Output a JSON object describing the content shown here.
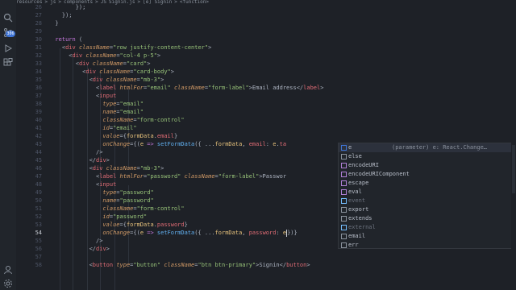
{
  "breadcrumb": [
    "resources",
    ">",
    "js",
    ">",
    "components",
    ">",
    "JS",
    "Signin.js",
    ">",
    "[e] Signin",
    ">",
    "<function>"
  ],
  "activity": {
    "badge": "306"
  },
  "line_numbers": [
    "26",
    "27",
    "28",
    "29",
    "30",
    "31",
    "32",
    "33",
    "34",
    "35",
    "36",
    "37",
    "38",
    "39",
    "40",
    "41",
    "42",
    "43",
    "44",
    "45",
    "46",
    "47",
    "48",
    "49",
    "50",
    "51",
    "52",
    "53",
    "54",
    "55",
    "56",
    "57",
    "58"
  ],
  "active_line": "54",
  "code": [
    [
      [
        "t-punc",
        "        });"
      ]
    ],
    [
      [
        "t-punc",
        "    });"
      ]
    ],
    [
      [
        "t-punc",
        "  }"
      ]
    ],
    [
      [
        "t-punc",
        ""
      ]
    ],
    [
      [
        "t-kw",
        "  return"
      ],
      [
        "t-punc",
        " ("
      ]
    ],
    [
      [
        "t-punc",
        "    <"
      ],
      [
        "t-tag",
        "div"
      ],
      [
        "t-attr",
        " className"
      ],
      [
        "t-punc",
        "="
      ],
      [
        "t-str",
        "\"row justify-content-center\""
      ],
      [
        "t-punc",
        ">"
      ]
    ],
    [
      [
        "t-punc",
        "      <"
      ],
      [
        "t-tag",
        "div"
      ],
      [
        "t-attr",
        " className"
      ],
      [
        "t-punc",
        "="
      ],
      [
        "t-str",
        "\"col-4 p-5\""
      ],
      [
        "t-punc",
        ">"
      ]
    ],
    [
      [
        "t-punc",
        "        <"
      ],
      [
        "t-tag",
        "div"
      ],
      [
        "t-attr",
        " className"
      ],
      [
        "t-punc",
        "="
      ],
      [
        "t-str",
        "\"card\""
      ],
      [
        "t-punc",
        ">"
      ]
    ],
    [
      [
        "t-punc",
        "          <"
      ],
      [
        "t-tag",
        "div"
      ],
      [
        "t-attr",
        " className"
      ],
      [
        "t-punc",
        "="
      ],
      [
        "t-str",
        "\"card-body\""
      ],
      [
        "t-punc",
        ">"
      ]
    ],
    [
      [
        "t-punc",
        "            <"
      ],
      [
        "t-tag",
        "div"
      ],
      [
        "t-attr",
        " className"
      ],
      [
        "t-punc",
        "="
      ],
      [
        "t-str",
        "\"mb-3\""
      ],
      [
        "t-punc",
        ">"
      ]
    ],
    [
      [
        "t-punc",
        "              <"
      ],
      [
        "t-tag",
        "label"
      ],
      [
        "t-attr",
        " htmlFor"
      ],
      [
        "t-punc",
        "="
      ],
      [
        "t-str",
        "\"email\""
      ],
      [
        "t-attr",
        " className"
      ],
      [
        "t-punc",
        "="
      ],
      [
        "t-str",
        "\"form-label\""
      ],
      [
        "t-punc",
        ">Email address</"
      ],
      [
        "t-tag",
        "label"
      ],
      [
        "t-punc",
        ">"
      ]
    ],
    [
      [
        "t-punc",
        "              <"
      ],
      [
        "t-tag",
        "input"
      ]
    ],
    [
      [
        "t-attr",
        "                type"
      ],
      [
        "t-punc",
        "="
      ],
      [
        "t-str",
        "\"email\""
      ]
    ],
    [
      [
        "t-attr",
        "                name"
      ],
      [
        "t-punc",
        "="
      ],
      [
        "t-str",
        "\"email\""
      ]
    ],
    [
      [
        "t-attr",
        "                className"
      ],
      [
        "t-punc",
        "="
      ],
      [
        "t-str",
        "\"form-control\""
      ]
    ],
    [
      [
        "t-attr",
        "                id"
      ],
      [
        "t-punc",
        "="
      ],
      [
        "t-str",
        "\"email\""
      ]
    ],
    [
      [
        "t-attr",
        "                value"
      ],
      [
        "t-punc",
        "={"
      ],
      [
        "t-var",
        "formData"
      ],
      [
        "t-punc",
        "."
      ],
      [
        "t-prop",
        "email"
      ],
      [
        "t-punc",
        "}"
      ]
    ],
    [
      [
        "t-attr",
        "                onChange"
      ],
      [
        "t-punc",
        "={("
      ],
      [
        "t-var",
        "e"
      ],
      [
        "t-kw",
        " =>"
      ],
      [
        "t-fn",
        " setFormData"
      ],
      [
        "t-punc",
        "({ ..."
      ],
      [
        "t-var",
        "formData"
      ],
      [
        "t-punc",
        ", "
      ],
      [
        "t-prop",
        "email"
      ],
      [
        "t-punc",
        ": "
      ],
      [
        "t-var",
        "e"
      ],
      [
        "t-punc",
        "."
      ],
      [
        "t-prop",
        "ta"
      ]
    ],
    [
      [
        "t-punc",
        "              />"
      ]
    ],
    [
      [
        "t-punc",
        "            </"
      ],
      [
        "t-tag",
        "div"
      ],
      [
        "t-punc",
        ">"
      ]
    ],
    [
      [
        "t-punc",
        "            <"
      ],
      [
        "t-tag",
        "div"
      ],
      [
        "t-attr",
        " className"
      ],
      [
        "t-punc",
        "="
      ],
      [
        "t-str",
        "\"mb-3\""
      ],
      [
        "t-punc",
        ">"
      ]
    ],
    [
      [
        "t-punc",
        "              <"
      ],
      [
        "t-tag",
        "label"
      ],
      [
        "t-attr",
        " htmlFor"
      ],
      [
        "t-punc",
        "="
      ],
      [
        "t-str",
        "\"password\""
      ],
      [
        "t-attr",
        " className"
      ],
      [
        "t-punc",
        "="
      ],
      [
        "t-str",
        "\"form-label\""
      ],
      [
        "t-punc",
        ">Passwor"
      ]
    ],
    [
      [
        "t-punc",
        "              <"
      ],
      [
        "t-tag",
        "input"
      ]
    ],
    [
      [
        "t-attr",
        "                type"
      ],
      [
        "t-punc",
        "="
      ],
      [
        "t-str",
        "\"password\""
      ]
    ],
    [
      [
        "t-attr",
        "                name"
      ],
      [
        "t-punc",
        "="
      ],
      [
        "t-str",
        "\"password\""
      ]
    ],
    [
      [
        "t-attr",
        "                className"
      ],
      [
        "t-punc",
        "="
      ],
      [
        "t-str",
        "\"form-control\""
      ]
    ],
    [
      [
        "t-attr",
        "                id"
      ],
      [
        "t-punc",
        "="
      ],
      [
        "t-str",
        "\"password\""
      ]
    ],
    [
      [
        "t-attr",
        "                value"
      ],
      [
        "t-punc",
        "={"
      ],
      [
        "t-var",
        "formData"
      ],
      [
        "t-punc",
        "."
      ],
      [
        "t-prop",
        "password"
      ],
      [
        "t-punc",
        "}"
      ]
    ],
    [
      [
        "t-attr",
        "                onChange"
      ],
      [
        "t-punc",
        "={("
      ],
      [
        "t-var",
        "e"
      ],
      [
        "t-kw",
        " =>"
      ],
      [
        "t-fn",
        " setFormData"
      ],
      [
        "t-punc",
        "({ ..."
      ],
      [
        "t-var",
        "formData"
      ],
      [
        "t-punc",
        ", "
      ],
      [
        "t-prop",
        "password"
      ],
      [
        "t-punc",
        ": "
      ],
      [
        "t-var",
        "e"
      ],
      [
        "CURSOR",
        ""
      ],
      [
        "t-punc",
        "})}"
      ]
    ],
    [
      [
        "t-punc",
        "              />"
      ]
    ],
    [
      [
        "t-punc",
        "            </"
      ],
      [
        "t-tag",
        "div"
      ],
      [
        "t-punc",
        ">"
      ]
    ],
    [
      [
        "t-punc",
        ""
      ]
    ],
    [
      [
        "t-punc",
        "            <"
      ],
      [
        "t-tag",
        "button"
      ],
      [
        "t-attr",
        " type"
      ],
      [
        "t-punc",
        "="
      ],
      [
        "t-str",
        "\"button\""
      ],
      [
        "t-attr",
        " className"
      ],
      [
        "t-punc",
        "="
      ],
      [
        "t-str",
        "\"btn btn-primary\""
      ],
      [
        "t-punc",
        ">Signin</"
      ],
      [
        "t-tag",
        "button"
      ],
      [
        "t-punc",
        ">"
      ]
    ]
  ],
  "suggest": {
    "items": [
      {
        "label": "e",
        "detail": "(parameter) e: React.Change…",
        "kind": "param",
        "selected": true,
        "dim": false
      },
      {
        "label": "else",
        "detail": "",
        "kind": "keyword",
        "selected": false,
        "dim": false
      },
      {
        "label": "encodeURI",
        "detail": "",
        "kind": "function",
        "selected": false,
        "dim": false
      },
      {
        "label": "encodeURIComponent",
        "detail": "",
        "kind": "function",
        "selected": false,
        "dim": false
      },
      {
        "label": "escape",
        "detail": "",
        "kind": "function",
        "selected": false,
        "dim": false
      },
      {
        "label": "eval",
        "detail": "",
        "kind": "function",
        "selected": false,
        "dim": false
      },
      {
        "label": "event",
        "detail": "",
        "kind": "variable",
        "selected": false,
        "dim": true
      },
      {
        "label": "export",
        "detail": "",
        "kind": "keyword",
        "selected": false,
        "dim": false
      },
      {
        "label": "extends",
        "detail": "",
        "kind": "keyword",
        "selected": false,
        "dim": false
      },
      {
        "label": "external",
        "detail": "",
        "kind": "variable",
        "selected": false,
        "dim": true
      },
      {
        "label": "email",
        "detail": "",
        "kind": "word",
        "selected": false,
        "dim": false
      },
      {
        "label": "err",
        "detail": "",
        "kind": "word",
        "selected": false,
        "dim": false
      }
    ]
  },
  "colors": {
    "editor_bg": "#1e2127",
    "accent": "#3e74d6",
    "tag": "#e06c75",
    "attr": "#d19a66",
    "string": "#98c379",
    "keyword": "#c678dd",
    "function": "#61afef"
  }
}
